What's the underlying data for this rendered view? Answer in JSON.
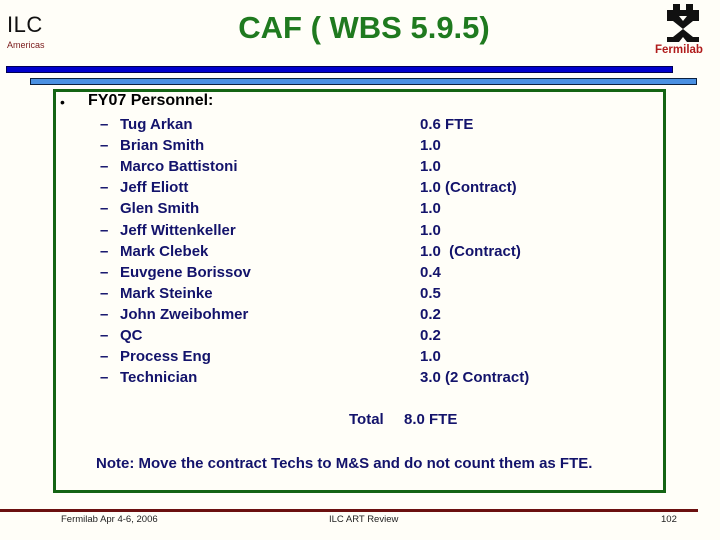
{
  "header": {
    "logo_text": "ILC",
    "logo_subtext": "Americas",
    "title": "CAF ( WBS 5.9.5)",
    "org_logo_text": "Fermilab",
    "colors": {
      "title": "#1f7a1f",
      "bar_dark": "#0000cc",
      "bar_light": "#4a90e2",
      "box_border": "#146414",
      "body_text": "#13136b",
      "footer_rule": "#6b1010",
      "fermilab_red": "#b01c1c"
    }
  },
  "main": {
    "bullet": "•",
    "heading": "FY07 Personnel:",
    "dash": "–",
    "personnel": [
      {
        "name": "Tug Arkan",
        "fte": "0.6 FTE"
      },
      {
        "name": "Brian Smith",
        "fte": "1.0"
      },
      {
        "name": "Marco Battistoni",
        "fte": "1.0"
      },
      {
        "name": "Jeff Eliott",
        "fte": "1.0 (Contract)"
      },
      {
        "name": "Glen Smith",
        "fte": "1.0"
      },
      {
        "name": "Jeff Wittenkeller",
        "fte": "1.0"
      },
      {
        "name": "Mark Clebek",
        "fte": "1.0  (Contract)"
      },
      {
        "name": "Euvgene Borissov",
        "fte": "0.4"
      },
      {
        "name": "Mark Steinke",
        "fte": "0.5"
      },
      {
        "name": "John Zweibohmer",
        "fte": "0.2"
      },
      {
        "name": "QC",
        "fte": "0.2"
      },
      {
        "name": "Process Eng",
        "fte": "1.0"
      },
      {
        "name": "Technician",
        "fte": "3.0 (2 Contract)"
      }
    ],
    "total_label": "Total",
    "total_value": "8.0 FTE",
    "note": "Note: Move the contract Techs to M&S and do not count them as FTE."
  },
  "footer": {
    "left": "Fermilab Apr 4-6, 2006",
    "center": "ILC ART Review",
    "page_number": "102"
  }
}
